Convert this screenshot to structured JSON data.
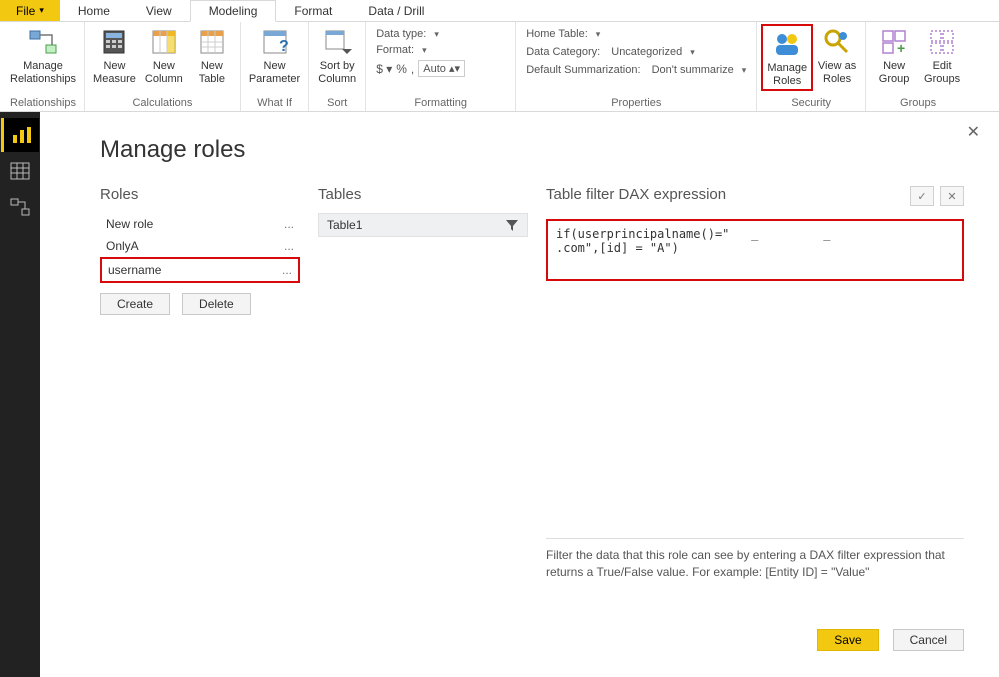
{
  "tabs": {
    "file": "File",
    "items": [
      "Home",
      "View",
      "Modeling",
      "Format",
      "Data / Drill"
    ],
    "active": "Modeling"
  },
  "ribbon": {
    "relationships": {
      "name": "Relationships",
      "manage": "Manage\nRelationships"
    },
    "calculations": {
      "name": "Calculations",
      "new_measure": "New\nMeasure",
      "new_column": "New\nColumn",
      "new_table": "New\nTable"
    },
    "whatif": {
      "name": "What If",
      "new_parameter": "New\nParameter"
    },
    "sort": {
      "name": "Sort",
      "sort_by": "Sort by\nColumn"
    },
    "formatting": {
      "name": "Formatting",
      "datatype": "Data type:",
      "format": "Format:",
      "auto": "Auto"
    },
    "properties": {
      "name": "Properties",
      "home_table": "Home Table:",
      "data_category_lbl": "Data Category:",
      "data_category_val": "Uncategorized",
      "summ_lbl": "Default Summarization:",
      "summ_val": "Don't summarize"
    },
    "security": {
      "name": "Security",
      "manage_roles": "Manage\nRoles",
      "view_as": "View as\nRoles"
    },
    "groups": {
      "name": "Groups",
      "new_group": "New\nGroup",
      "edit_groups": "Edit\nGroups"
    }
  },
  "dialog": {
    "title": "Manage roles",
    "roles_hdr": "Roles",
    "tables_hdr": "Tables",
    "dax_hdr": "Table filter DAX expression",
    "roles": [
      {
        "name": "New role",
        "selected": false
      },
      {
        "name": "OnlyA",
        "selected": false
      },
      {
        "name": "username",
        "selected": true
      }
    ],
    "create": "Create",
    "delete": "Delete",
    "tables": [
      "Table1"
    ],
    "dax": "if(userprincipalname()=\"   _         _            .com\",[id] = \"A\")",
    "hint": "Filter the data that this role can see by entering a DAX filter expression that returns a True/False value. For example: [Entity ID] = \"Value\"",
    "save": "Save",
    "cancel": "Cancel"
  }
}
